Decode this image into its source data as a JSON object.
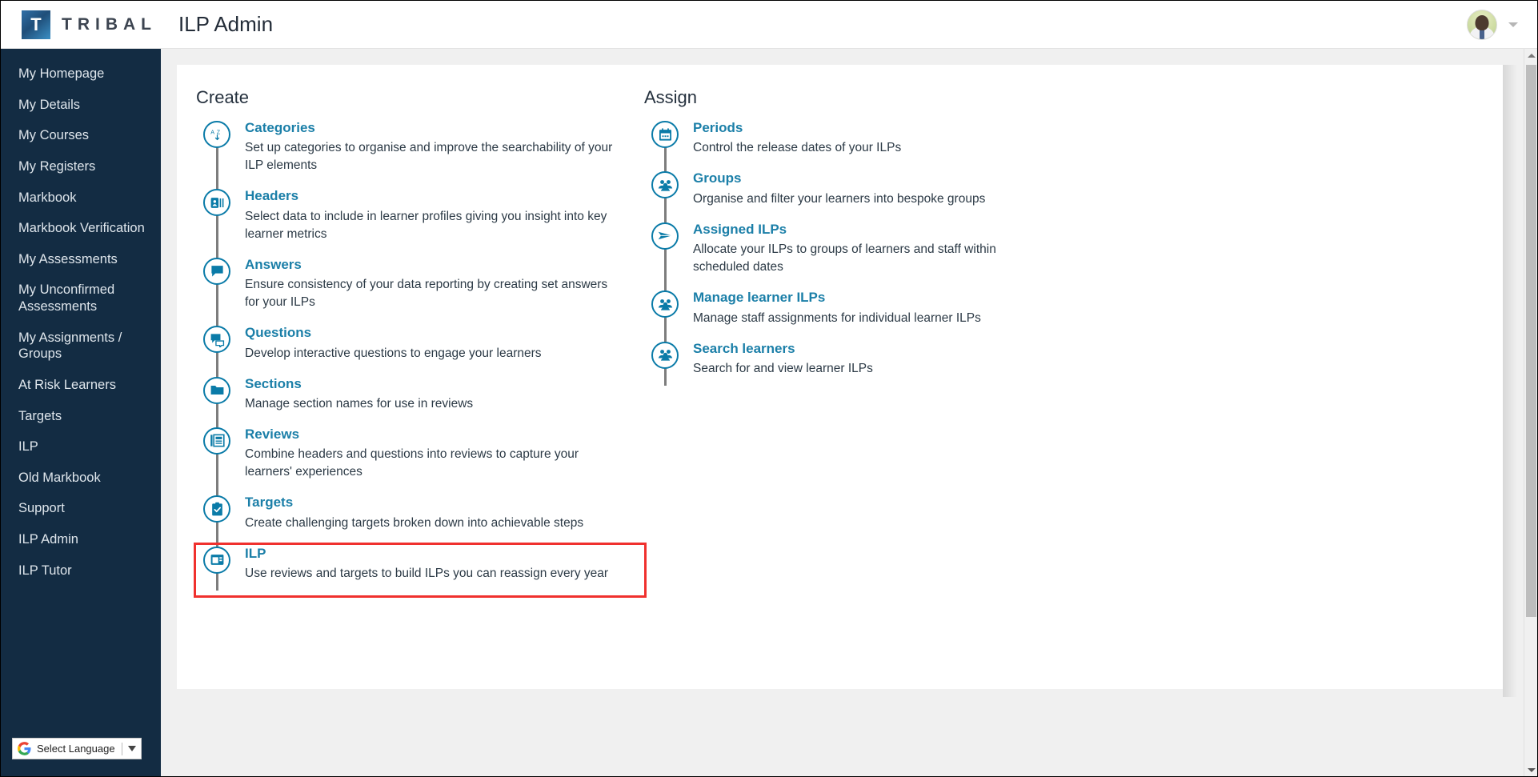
{
  "brand": {
    "tile_letter": "T",
    "name": "TRIBAL"
  },
  "header": {
    "page_title": "ILP Admin",
    "avatar_icon": "user-avatar-photo",
    "caret_icon": "chevron-down-icon"
  },
  "sidebar": {
    "items": [
      {
        "label": "My Homepage"
      },
      {
        "label": "My Details"
      },
      {
        "label": "My Courses"
      },
      {
        "label": "My Registers"
      },
      {
        "label": "Markbook"
      },
      {
        "label": "Markbook Verification"
      },
      {
        "label": "My Assessments"
      },
      {
        "label": "My Unconfirmed Assessments"
      },
      {
        "label": "My Assignments / Groups"
      },
      {
        "label": "At Risk Learners"
      },
      {
        "label": "Targets"
      },
      {
        "label": "ILP"
      },
      {
        "label": "Old Markbook"
      },
      {
        "label": "Support"
      },
      {
        "label": "ILP Admin"
      },
      {
        "label": "ILP Tutor"
      }
    ],
    "language_widget": {
      "icon": "google-logo-icon",
      "label": "Select Language",
      "caret_icon": "caret-down-icon"
    }
  },
  "main": {
    "columns": [
      {
        "key": "create",
        "heading": "Create",
        "items": [
          {
            "icon": "az-sort-icon",
            "title": "Categories",
            "description": "Set up categories to organise and improve the searchability of your ILP elements",
            "highlighted": false
          },
          {
            "icon": "id-card-icon",
            "title": "Headers",
            "description": "Select data to include in learner profiles giving you insight into key learner metrics",
            "highlighted": false
          },
          {
            "icon": "speech-bubble-icon",
            "title": "Answers",
            "description": "Ensure consistency of your data reporting by creating set answers for your ILPs",
            "highlighted": false
          },
          {
            "icon": "chat-bubbles-icon",
            "title": "Questions",
            "description": "Develop interactive questions to engage your learners",
            "highlighted": false
          },
          {
            "icon": "folder-icon",
            "title": "Sections",
            "description": "Manage section names for use in reviews",
            "highlighted": false
          },
          {
            "icon": "document-list-icon",
            "title": "Reviews",
            "description": "Combine headers and questions into reviews to capture your learners' experiences",
            "highlighted": false
          },
          {
            "icon": "clipboard-check-icon",
            "title": "Targets",
            "description": "Create challenging targets broken down into achievable steps",
            "highlighted": false
          },
          {
            "icon": "window-layout-icon",
            "title": "ILP",
            "description": "Use reviews and targets to build ILPs you can reassign every year",
            "highlighted": true
          }
        ]
      },
      {
        "key": "assign",
        "heading": "Assign",
        "items": [
          {
            "icon": "calendar-icon",
            "title": "Periods",
            "description": "Control the release dates of your ILPs",
            "highlighted": false
          },
          {
            "icon": "people-group-icon",
            "title": "Groups",
            "description": "Organise and filter your learners into bespoke groups",
            "highlighted": false
          },
          {
            "icon": "paper-plane-icon",
            "title": "Assigned ILPs",
            "description": "Allocate your ILPs to groups of learners and staff within scheduled dates",
            "highlighted": false
          },
          {
            "icon": "people-group-icon",
            "title": "Manage learner ILPs",
            "description": "Manage staff assignments for individual learner ILPs",
            "highlighted": false
          },
          {
            "icon": "people-group-icon",
            "title": "Search learners",
            "description": "Search for and view learner ILPs",
            "highlighted": false
          }
        ]
      }
    ]
  },
  "scrollbar": {
    "up_icon": "scroll-up-arrow-icon",
    "down_icon": "scroll-down-arrow-icon"
  },
  "colors": {
    "sidebar_bg": "#132c43",
    "accent_link": "#1b7fa8",
    "icon_teal": "#0a7ba8",
    "highlight_border": "#f0312e",
    "page_bg": "#f0f0f0"
  }
}
